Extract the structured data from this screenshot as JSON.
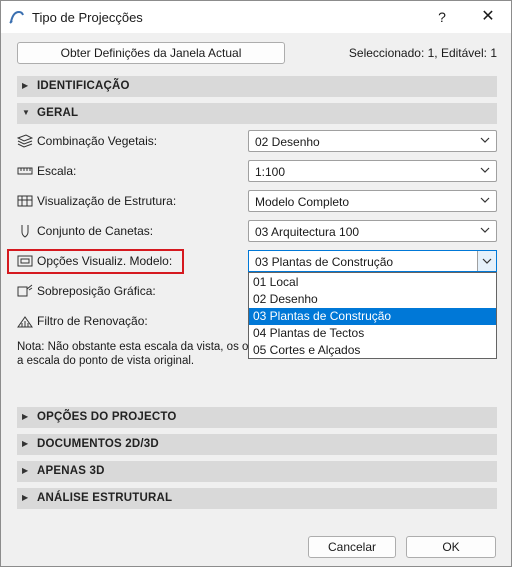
{
  "window": {
    "title": "Tipo de Projecções",
    "help_label": "?",
    "close_label": "✕"
  },
  "top": {
    "get_settings_label": "Obter Definições da Janela Actual",
    "selection_info": "Seleccionado: 1, Editável: 1"
  },
  "sections_top": [
    {
      "label": "IDENTIFICAÇÃO",
      "expanded": false
    },
    {
      "label": "GERAL",
      "expanded": true
    }
  ],
  "general": {
    "rows": [
      {
        "label": "Combinação Vegetais:",
        "icon": "layers-icon",
        "value": "02 Desenho"
      },
      {
        "label": "Escala:",
        "icon": "ruler-icon",
        "value": "1:100"
      },
      {
        "label": "Visualização de Estrutura:",
        "icon": "structure-icon",
        "value": "Modelo Completo"
      },
      {
        "label": "Conjunto de Canetas:",
        "icon": "pen-icon",
        "value": "03 Arquitectura 100"
      },
      {
        "label": "Opções Visualiz. Modelo:",
        "icon": "model-view-icon",
        "value": "03 Plantas de Construção"
      },
      {
        "label": "Sobreposição Gráfica:",
        "icon": "graphic-override-icon"
      },
      {
        "label": "Filtro de Renovação:",
        "icon": "renovation-filter-icon"
      }
    ],
    "dropdown_options": [
      "01 Local",
      "02 Desenho",
      "03 Plantas de Construção",
      "04 Plantas de Tectos",
      "05 Cortes e Alçados"
    ],
    "selected_option": "03 Plantas de Construção",
    "note_line1": "Nota: Não obstante esta escala da vista, os o",
    "note_line2": "a escala do ponto de vista original."
  },
  "sections_bottom": [
    {
      "label": "OPÇÕES DO PROJECTO",
      "expanded": false
    },
    {
      "label": "DOCUMENTOS 2D/3D",
      "expanded": false
    },
    {
      "label": "APENAS 3D",
      "expanded": false
    },
    {
      "label": "ANÁLISE ESTRUTURAL",
      "expanded": false
    }
  ],
  "footer": {
    "cancel_label": "Cancelar",
    "ok_label": "OK"
  },
  "colors": {
    "highlight_border": "#d5191f",
    "selection_blue": "#0078d7",
    "section_bg": "#d9d9d9"
  }
}
